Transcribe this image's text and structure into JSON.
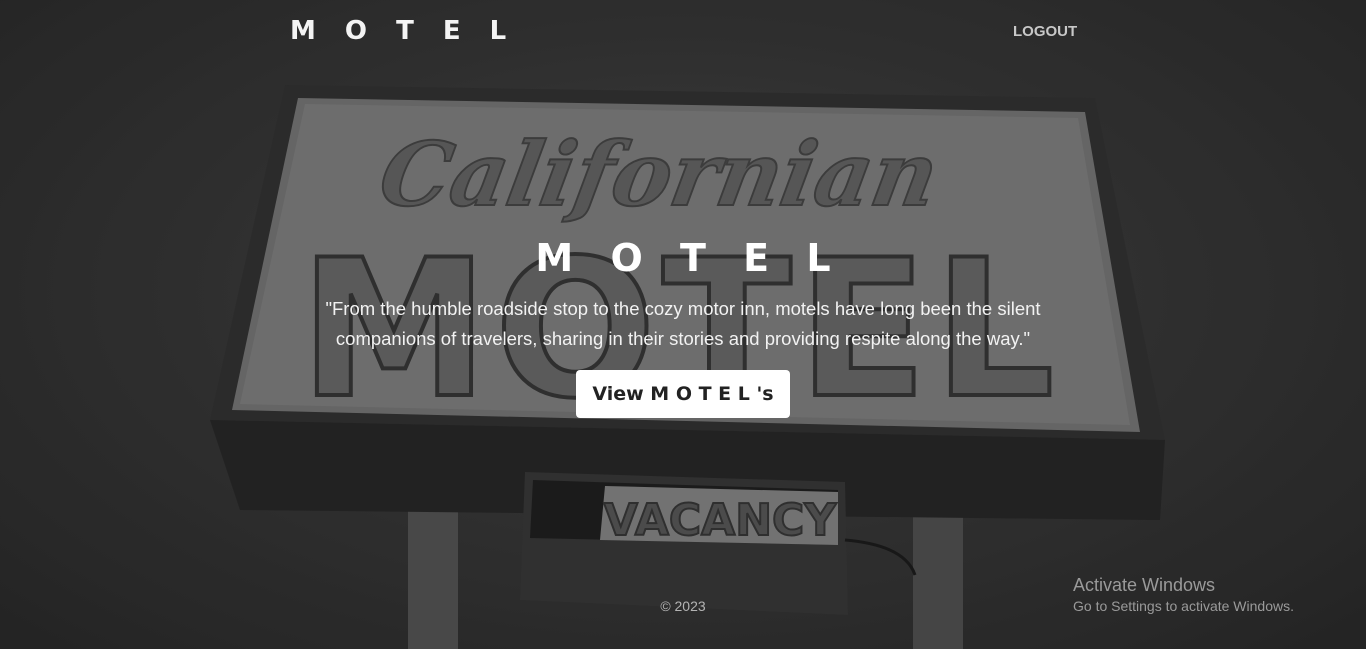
{
  "navbar": {
    "brand": "M O T E L",
    "logout_label": "LOGOUT"
  },
  "hero": {
    "title": "M O T E L",
    "quote": "\"From the humble roadside stop to the cozy motor inn, motels have long been the silent companions of travelers, sharing in their stories and providing respite along the way.\"",
    "cta_label": "View M O T E L 's"
  },
  "background_sign": {
    "script_text": "Californian",
    "big_text": "MOTEL",
    "vacancy_text": "VACANCY"
  },
  "footer": {
    "copyright": "© 2023"
  },
  "os_watermark": {
    "title": "Activate Windows",
    "subtitle": "Go to Settings to activate Windows."
  }
}
